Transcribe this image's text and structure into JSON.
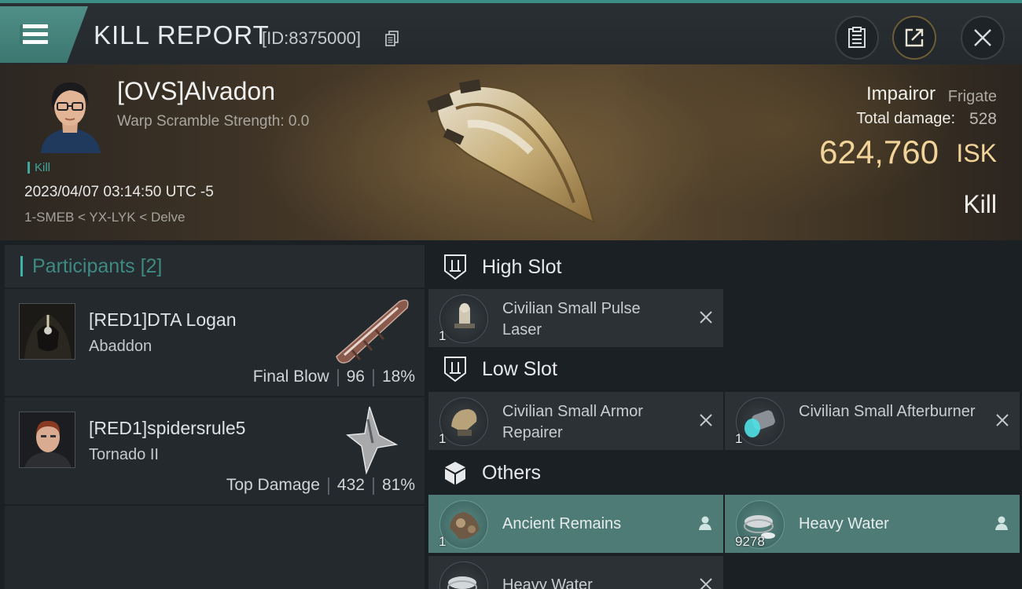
{
  "header": {
    "title": "KILL REPORT",
    "report_id": "[ID:8375000]",
    "icons": [
      "menu-icon",
      "copy-icon",
      "clipboard-icon",
      "share-icon",
      "close-icon"
    ]
  },
  "victim": {
    "name": "[OVS]Alvadon",
    "warp_scramble": "Warp Scramble Strength: 0.0",
    "tag": "Kill",
    "datetime": "2023/04/07 03:14:50 UTC -5",
    "location": "1-SMEB < YX-LYK < Delve",
    "ship_name": "Impairor",
    "ship_class": "Frigate",
    "damage_label": "Total damage:",
    "damage_value": "528",
    "isk_value": "624,760",
    "isk_unit": "ISK",
    "result": "Kill"
  },
  "participants": {
    "label": "Participants",
    "count": "[2]",
    "list": [
      {
        "name": "[RED1]DTA Logan",
        "ship": "Abaddon",
        "role": "Final Blow",
        "damage": "96",
        "percent": "18%"
      },
      {
        "name": "[RED1]spidersrule5",
        "ship": "Tornado II",
        "role": "Top Damage",
        "damage": "432",
        "percent": "81%"
      }
    ]
  },
  "slots": {
    "high": {
      "title": "High Slot",
      "items": [
        {
          "name": "Civilian Small Pulse Laser",
          "qty": "1"
        }
      ]
    },
    "low": {
      "title": "Low Slot",
      "items": [
        {
          "name": "Civilian Small Armor Repairer",
          "qty": "1"
        },
        {
          "name": "Civilian Small Afterburner",
          "qty": "1"
        }
      ]
    },
    "others": {
      "title": "Others",
      "items": [
        {
          "name": "Ancient Remains",
          "qty": "1"
        },
        {
          "name": "Heavy Water",
          "qty": "9278"
        },
        {
          "name": "Heavy Water",
          "qty": ""
        }
      ]
    }
  },
  "colors": {
    "accent": "#3fb2a5",
    "isk": "#f2d39a",
    "highlight": "#4e7b76"
  }
}
